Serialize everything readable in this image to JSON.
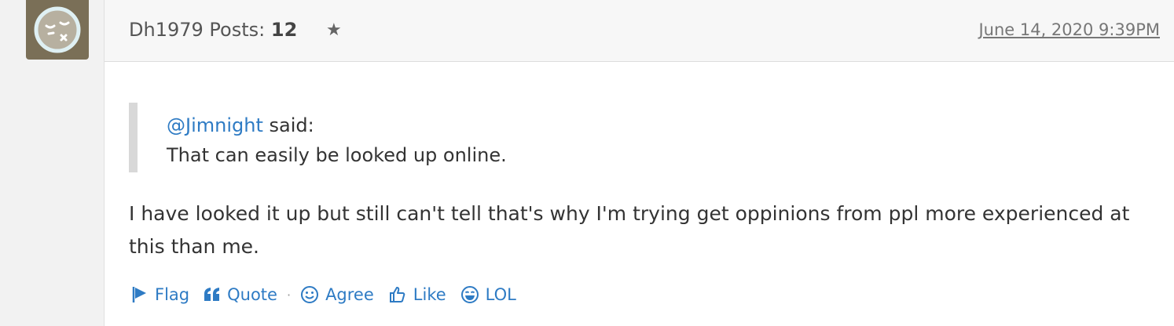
{
  "author": {
    "name": "Dh1979",
    "posts_label": "Posts:",
    "posts_count": "12"
  },
  "post": {
    "date": "June 14, 2020 9:39PM",
    "quote": {
      "mention": "@Jimnight",
      "said": " said:",
      "text": "That can easily be looked up online."
    },
    "body": "I have looked it up but still can't tell that's why I'm trying get oppinions from ppl more experienced at this than me."
  },
  "actions": {
    "flag": "Flag",
    "quote": "Quote",
    "separator": "·",
    "agree": "Agree",
    "like": "Like",
    "lol": "LOL"
  },
  "colors": {
    "link": "#2e7bc4",
    "avatar_bg": "#7a6f57"
  }
}
